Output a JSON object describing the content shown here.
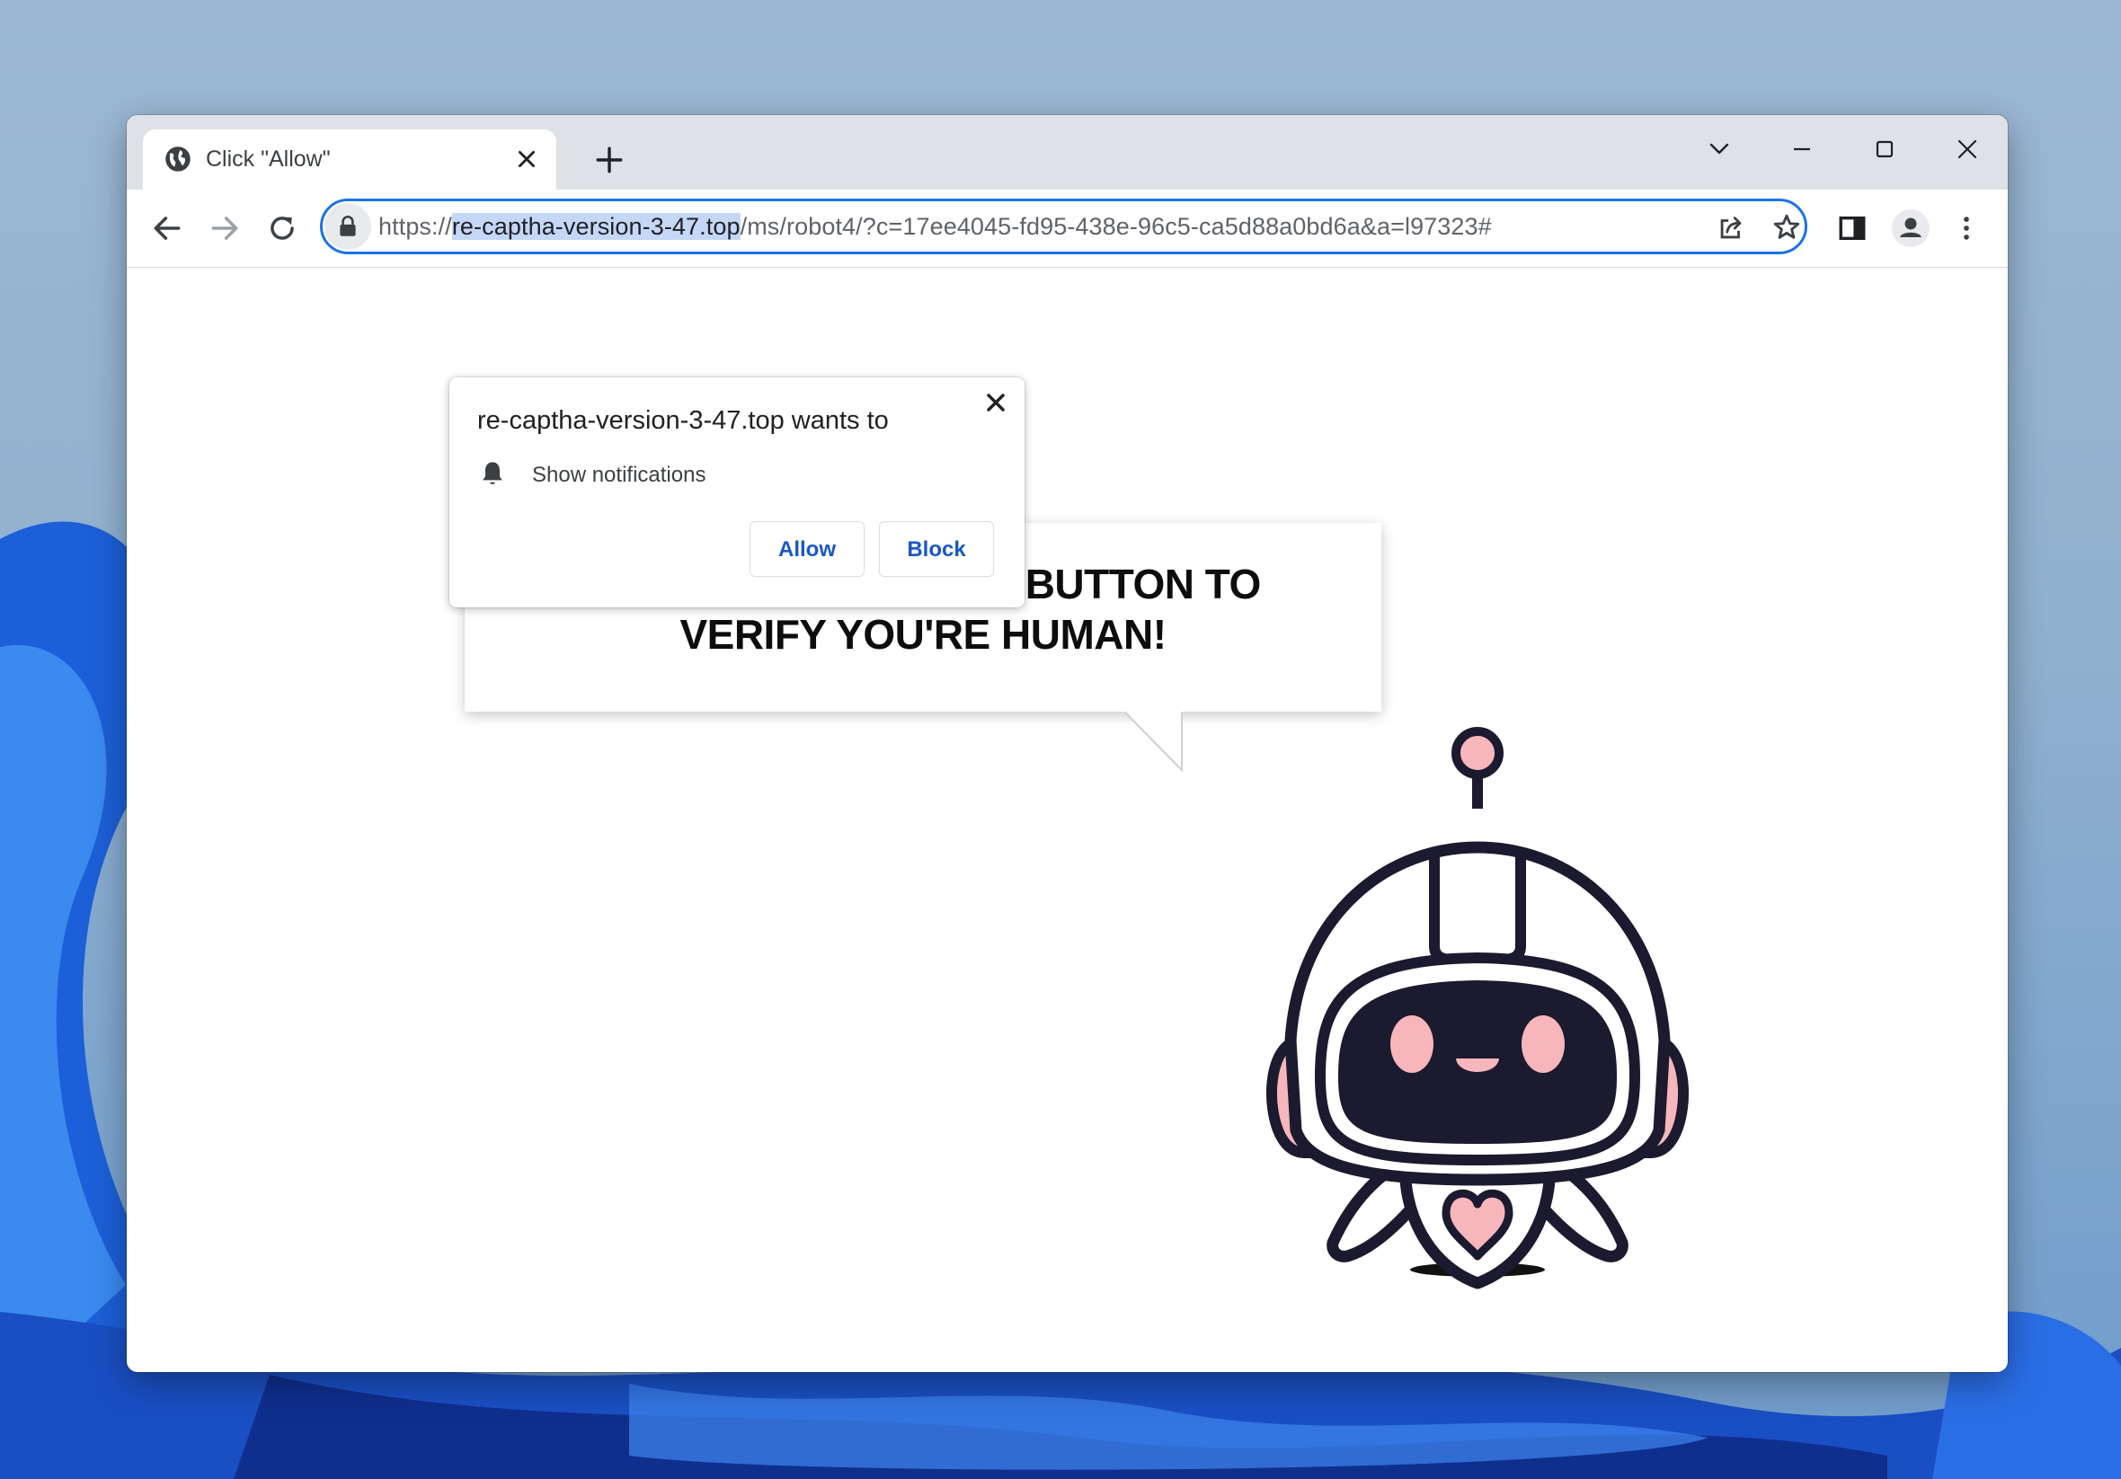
{
  "browser": {
    "tab": {
      "title": "Click \"Allow\""
    },
    "address_bar": {
      "url_prefix": "https://",
      "url_domain": "re-captha-version-3-47.top",
      "url_rest": "/ms/robot4/?c=17ee4045-fd95-438e-96c5-ca5d88a0bd6a&a=l97323#"
    }
  },
  "permission_prompt": {
    "title": "re-captha-version-3-47.top wants to",
    "permission": "Show notifications",
    "allow_label": "Allow",
    "block_label": "Block"
  },
  "page": {
    "speech_bubble_text": "PRESS THE \"ALLOW\" BUTTON TO VERIFY YOU'RE HUMAN!"
  },
  "icons": [
    "globe-icon",
    "close-icon",
    "plus-icon",
    "chevron-down-icon",
    "minimize-icon",
    "maximize-icon",
    "close-window-icon",
    "back-arrow-icon",
    "forward-arrow-icon",
    "reload-icon",
    "lock-icon",
    "share-icon",
    "star-icon",
    "side-panel-icon",
    "profile-icon",
    "kebab-menu-icon",
    "bell-icon"
  ],
  "colors": {
    "accent": "#1a73e8",
    "button_text": "#1a56c8",
    "robot_pink": "#f6b6bb",
    "robot_dark": "#1c1a2e"
  }
}
